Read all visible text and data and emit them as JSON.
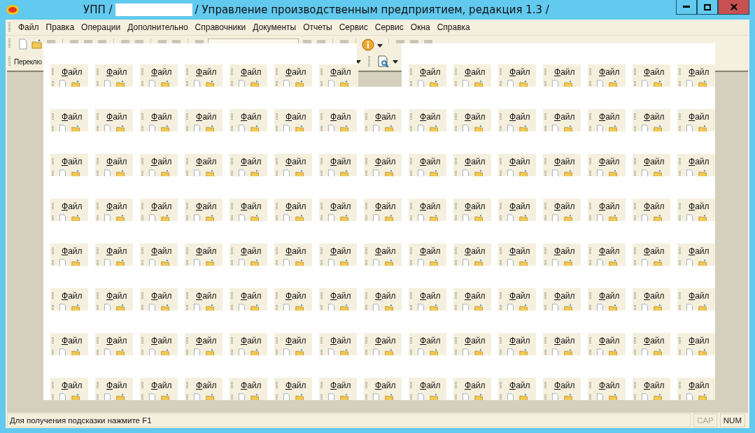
{
  "window": {
    "title_prefix": "УПП /",
    "title_rest": "/  Управление производственным предприятием, редакция 1.3 /"
  },
  "menu": [
    "Файл",
    "Правка",
    "Операции",
    "Дополнительно",
    "Справочники",
    "Документы",
    "Отчеты",
    "Сервис",
    "Сервис",
    "Окна",
    "Справка"
  ],
  "toolbar": {
    "panel_label": "Переклю"
  },
  "glitch": {
    "rows": [
      {
        "tiles": [
          {
            "kind": "tile",
            "label": "Файл"
          },
          {
            "kind": "tile",
            "label": "Файл"
          },
          {
            "kind": "tile",
            "label": "Файл"
          },
          {
            "kind": "tile",
            "label": "Файл"
          },
          {
            "kind": "tile",
            "label": "Файл"
          },
          {
            "kind": "tile",
            "label": "Файл"
          },
          {
            "kind": "tile",
            "label": "Файл"
          },
          {
            "kind": "gap"
          },
          {
            "kind": "tile",
            "label": "Файл"
          },
          {
            "kind": "tile",
            "label": "Файл"
          },
          {
            "kind": "tile",
            "label": "Файл"
          },
          {
            "kind": "tile",
            "label": "Файл"
          },
          {
            "kind": "tile",
            "label": "Файл"
          },
          {
            "kind": "tile",
            "label": "Файл"
          },
          {
            "kind": "tile",
            "label": "Файл"
          }
        ]
      },
      {
        "tiles": [
          {
            "kind": "tile",
            "label": "Файл"
          },
          {
            "kind": "tile",
            "label": "Файл"
          },
          {
            "kind": "tile",
            "label": "Файл"
          },
          {
            "kind": "tile",
            "label": "Файл"
          },
          {
            "kind": "tile",
            "label": "Файл"
          },
          {
            "kind": "tile",
            "label": "Файл"
          },
          {
            "kind": "tile",
            "label": "Файл"
          },
          {
            "kind": "tile",
            "label": "Файл"
          },
          {
            "kind": "tile",
            "label": "Файл"
          },
          {
            "kind": "tile",
            "label": "Файл"
          },
          {
            "kind": "tile",
            "label": "Файл"
          },
          {
            "kind": "tile",
            "label": "Файл"
          },
          {
            "kind": "tile",
            "label": "Файл"
          },
          {
            "kind": "tile",
            "label": "Файл"
          },
          {
            "kind": "tile",
            "label": "Файл"
          }
        ]
      },
      {
        "tiles": [
          {
            "kind": "tile",
            "label": "Файл"
          },
          {
            "kind": "tile",
            "label": "Файл"
          },
          {
            "kind": "tile",
            "label": "Файл"
          },
          {
            "kind": "tile",
            "label": "Файл"
          },
          {
            "kind": "tile",
            "label": "Файл"
          },
          {
            "kind": "tile",
            "label": "Файл"
          },
          {
            "kind": "tile",
            "label": "Файл"
          },
          {
            "kind": "tile",
            "label": "Файл"
          },
          {
            "kind": "tile",
            "label": "Файл"
          },
          {
            "kind": "tile",
            "label": "Файл"
          },
          {
            "kind": "tile",
            "label": "Файл"
          },
          {
            "kind": "tile",
            "label": "Файл"
          },
          {
            "kind": "tile",
            "label": "Файл"
          },
          {
            "kind": "tile",
            "label": "Файл"
          },
          {
            "kind": "tile",
            "label": "Файл"
          }
        ]
      },
      {
        "tiles": [
          {
            "kind": "tile",
            "label": "Файл"
          },
          {
            "kind": "tile",
            "label": "Файл"
          },
          {
            "kind": "tile",
            "label": "Файл"
          },
          {
            "kind": "tile",
            "label": "Файл"
          },
          {
            "kind": "tile",
            "label": "Файл"
          },
          {
            "kind": "tile",
            "label": "Файл"
          },
          {
            "kind": "tile",
            "label": "Файл"
          },
          {
            "kind": "tile",
            "label": "Файл"
          },
          {
            "kind": "tile",
            "label": "Файл"
          },
          {
            "kind": "tile",
            "label": "Файл"
          },
          {
            "kind": "tile",
            "label": "Файл"
          },
          {
            "kind": "tile",
            "label": "Файл"
          },
          {
            "kind": "tile",
            "label": "Файл"
          },
          {
            "kind": "tile",
            "label": "Файл"
          },
          {
            "kind": "tile",
            "label": "Файл"
          }
        ]
      },
      {
        "tiles": [
          {
            "kind": "tile",
            "label": "Файл"
          },
          {
            "kind": "tile",
            "label": "Файл"
          },
          {
            "kind": "tile",
            "label": "Файл"
          },
          {
            "kind": "tile",
            "label": "Файл"
          },
          {
            "kind": "tile",
            "label": "Файл"
          },
          {
            "kind": "tile",
            "label": "Файл"
          },
          {
            "kind": "tile",
            "label": "Файл"
          },
          {
            "kind": "tile",
            "label": "Файл"
          },
          {
            "kind": "tile",
            "label": "Файл"
          },
          {
            "kind": "tile",
            "label": "Файл"
          },
          {
            "kind": "tile",
            "label": "Файл"
          },
          {
            "kind": "tile",
            "label": "Файл"
          },
          {
            "kind": "tile",
            "label": "Файл"
          },
          {
            "kind": "tile",
            "label": "Файл"
          },
          {
            "kind": "tile",
            "label": "Файл"
          }
        ]
      },
      {
        "tiles": [
          {
            "kind": "tile",
            "label": "Файл"
          },
          {
            "kind": "tile",
            "label": "Файл"
          },
          {
            "kind": "tile",
            "label": "Файл"
          },
          {
            "kind": "tile",
            "label": "Файл"
          },
          {
            "kind": "tile",
            "label": "Файл"
          },
          {
            "kind": "tile",
            "label": "Файл"
          },
          {
            "kind": "tile",
            "label": "Файл"
          },
          {
            "kind": "tile",
            "label": "Файл"
          },
          {
            "kind": "tile",
            "label": "Файл"
          },
          {
            "kind": "tile",
            "label": "Файл"
          },
          {
            "kind": "tile",
            "label": "Файл"
          },
          {
            "kind": "tile",
            "label": "Файл"
          },
          {
            "kind": "tile",
            "label": "Файл"
          },
          {
            "kind": "tile",
            "label": "Файл"
          },
          {
            "kind": "tile",
            "label": "Файл"
          }
        ]
      },
      {
        "tiles": [
          {
            "kind": "tile",
            "label": "Файл"
          },
          {
            "kind": "tile",
            "label": "Файл"
          },
          {
            "kind": "tile",
            "label": "Файл"
          },
          {
            "kind": "tile",
            "label": "Файл"
          },
          {
            "kind": "tile",
            "label": "Файл"
          },
          {
            "kind": "tile",
            "label": "Файл"
          },
          {
            "kind": "tile",
            "label": "Файл"
          },
          {
            "kind": "tile",
            "label": "Файл"
          },
          {
            "kind": "tile",
            "label": "Файл"
          },
          {
            "kind": "tile",
            "label": "Файл"
          },
          {
            "kind": "tile",
            "label": "Файл"
          },
          {
            "kind": "tile",
            "label": "Файл"
          },
          {
            "kind": "tile",
            "label": "Файл"
          },
          {
            "kind": "tile",
            "label": "Файл"
          },
          {
            "kind": "tile",
            "label": "Файл"
          }
        ]
      },
      {
        "tiles": [
          {
            "kind": "tile",
            "label": "Файл"
          },
          {
            "kind": "tile",
            "label": "Файл"
          },
          {
            "kind": "tile",
            "label": "Файл"
          },
          {
            "kind": "tile",
            "label": "Файл"
          },
          {
            "kind": "tile",
            "label": "Файл"
          },
          {
            "kind": "tile",
            "label": "Файл"
          },
          {
            "kind": "tile",
            "label": "Файл"
          },
          {
            "kind": "tile",
            "label": "Файл"
          },
          {
            "kind": "tile",
            "label": "Файл"
          },
          {
            "kind": "tile",
            "label": "Файл"
          },
          {
            "kind": "tile",
            "label": "Файл"
          },
          {
            "kind": "tile",
            "label": "Файл"
          },
          {
            "kind": "tile",
            "label": "Файл"
          },
          {
            "kind": "tile",
            "label": "Файл"
          },
          {
            "kind": "tile",
            "label": "Файл"
          }
        ]
      }
    ]
  },
  "status_bar": {
    "hint": "Для получения подсказки нажмите F1",
    "indicators": [
      {
        "label": "CAP",
        "on": false
      },
      {
        "label": "NUM",
        "on": true
      }
    ]
  }
}
